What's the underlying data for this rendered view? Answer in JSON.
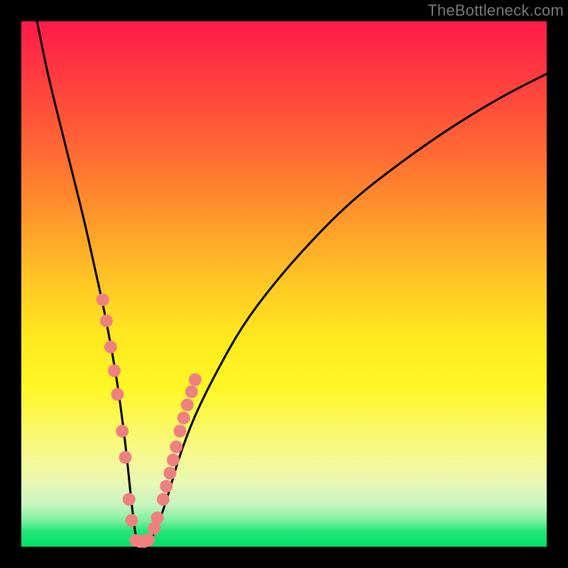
{
  "watermark": {
    "text": "TheBottleneck.com"
  },
  "chart_data": {
    "type": "line",
    "title": "",
    "xlabel": "",
    "ylabel": "",
    "xlim": [
      0,
      100
    ],
    "ylim": [
      0,
      100
    ],
    "grid": false,
    "series": [
      {
        "name": "bottleneck-curve",
        "x": [
          3,
          5,
          8,
          10,
          12,
          14,
          16,
          18,
          19,
          20,
          21,
          22,
          24,
          26,
          28,
          30,
          33,
          37,
          42,
          48,
          55,
          63,
          72,
          82,
          92,
          100
        ],
        "y": [
          100,
          90,
          78,
          70,
          62,
          53,
          44,
          33,
          26,
          18,
          8,
          0,
          0,
          4,
          10,
          17,
          25,
          33,
          42,
          50,
          58,
          66,
          73,
          80,
          86,
          90
        ]
      }
    ],
    "markers": {
      "name": "highlight-dots",
      "color": "#ee8080",
      "points_xy": [
        [
          15.5,
          47
        ],
        [
          16.2,
          43
        ],
        [
          17.0,
          38
        ],
        [
          17.7,
          33.5
        ],
        [
          18.3,
          29
        ],
        [
          19.2,
          22
        ],
        [
          19.8,
          17
        ],
        [
          20.5,
          9
        ],
        [
          21.0,
          5
        ],
        [
          21.8,
          1.2
        ],
        [
          22.6,
          1.0
        ],
        [
          23.4,
          1.0
        ],
        [
          24.2,
          1.3
        ],
        [
          25.3,
          3.5
        ],
        [
          25.9,
          5.5
        ],
        [
          27.0,
          9
        ],
        [
          27.6,
          11.5
        ],
        [
          28.3,
          14
        ],
        [
          28.9,
          16.5
        ],
        [
          29.5,
          19
        ],
        [
          30.2,
          22
        ],
        [
          30.9,
          24.5
        ],
        [
          31.6,
          27
        ],
        [
          32.4,
          29.5
        ],
        [
          33.1,
          31.8
        ]
      ]
    }
  }
}
